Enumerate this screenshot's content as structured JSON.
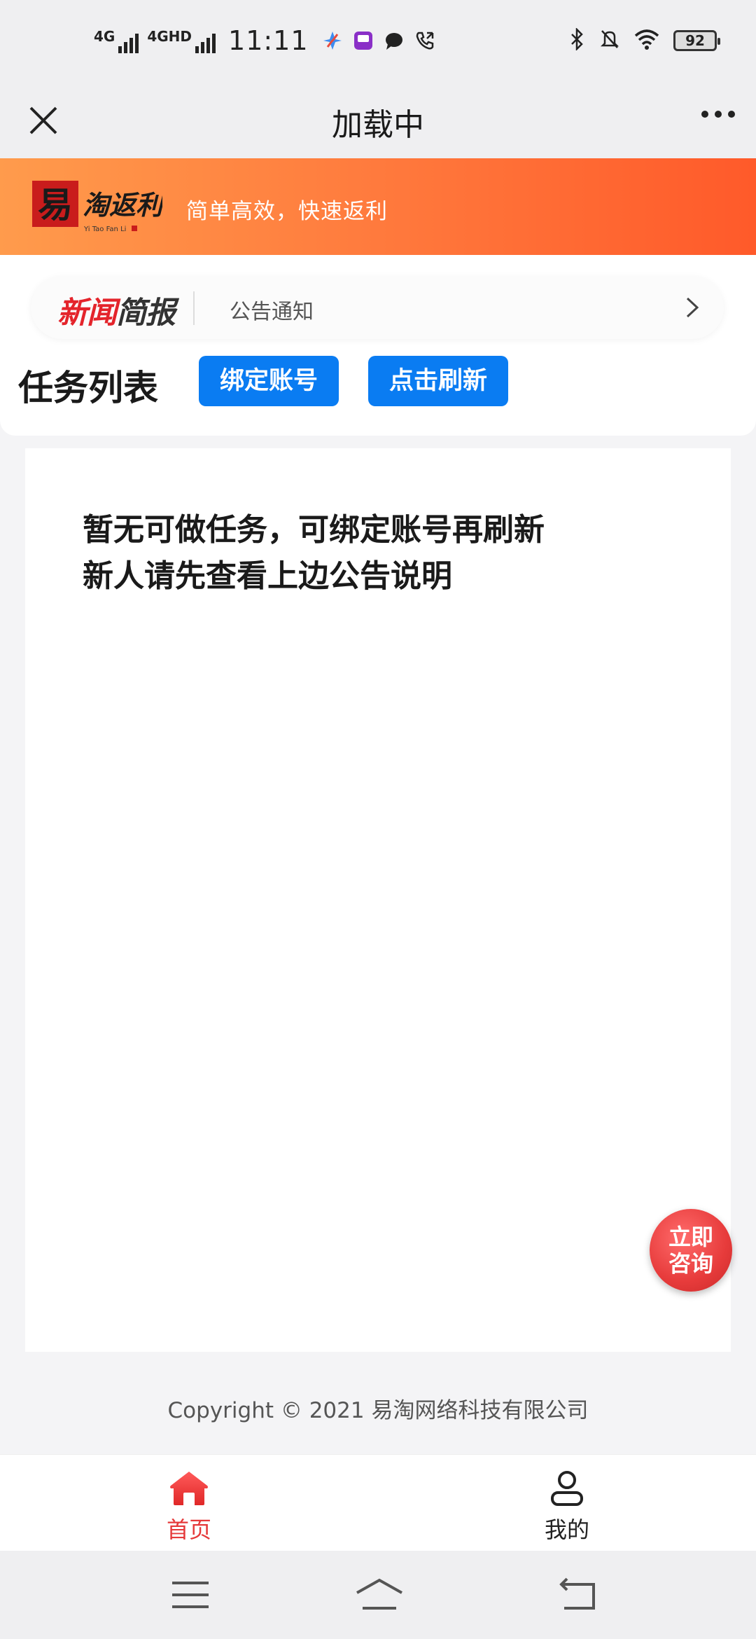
{
  "status_bar": {
    "net1": "4G",
    "net2": "4GHD",
    "time": "11:11",
    "battery": "92"
  },
  "nav": {
    "title": "加载中"
  },
  "banner": {
    "logo_main": "易淘返利",
    "logo_sub": "Yi Tao Fan Li",
    "slogan": "简单高效，快速返利"
  },
  "news": {
    "logo_red": "新闻",
    "logo_dark": "简报",
    "text": "公告通知"
  },
  "tasks": {
    "title": "任务列表",
    "bind_label": "绑定账号",
    "refresh_label": "点击刷新",
    "empty_line1": "暂无可做任务，可绑定账号再刷新",
    "empty_line2": "新人请先查看上边公告说明"
  },
  "consult": {
    "line1": "立即",
    "line2": "咨询"
  },
  "footer": {
    "copyright": "Copyright © 2021 易淘网络科技有限公司"
  },
  "tabbar": {
    "home": "首页",
    "me": "我的"
  },
  "colors": {
    "banner_start": "#ff9b4c",
    "banner_end": "#ff5a2a",
    "button_blue": "#0a7cf2",
    "active_red": "#e5393a"
  }
}
